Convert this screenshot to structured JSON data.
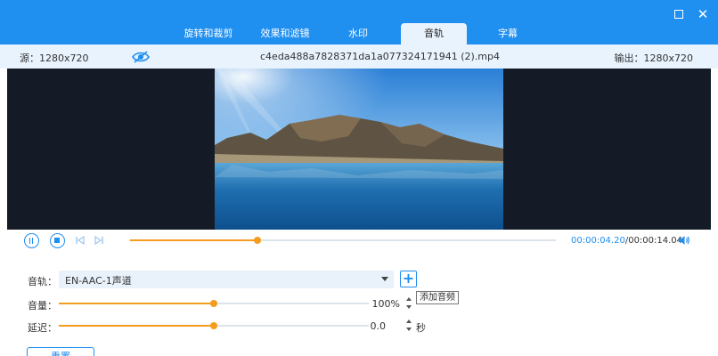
{
  "tabs": [
    {
      "label": "旋转和裁剪"
    },
    {
      "label": "效果和滤镜"
    },
    {
      "label": "水印"
    },
    {
      "label": "音轨",
      "active": true
    },
    {
      "label": "字幕"
    }
  ],
  "window": {
    "maximize_icon": "maximize-icon",
    "close_icon": "close-icon",
    "close_glyph": "✕"
  },
  "info": {
    "source": "源：1280x720",
    "filename": "c4eda488a7828371da1a077324171941 (2).mp4",
    "output": "输出：1280x720",
    "preview_icon": "eye-icon"
  },
  "playback": {
    "current": "00:00:04.20",
    "separator": "/",
    "total": "00:00:14.04",
    "progress": 0.3,
    "icons": [
      "pause-icon",
      "stop-icon",
      "skip-back-icon",
      "skip-forward-icon",
      "volume-icon"
    ]
  },
  "audio": {
    "track_label": "音轨：",
    "track_value": "EN-AAC-1声道",
    "add_button": "+",
    "add_tooltip": "添加音频",
    "volume_label": "音量：",
    "volume_value": "100%",
    "volume_level": 0.5,
    "delay_label": "延迟：",
    "delay_value": "0.0",
    "delay_unit": "秒",
    "delay_level": 0.5
  },
  "reset_label": "重置",
  "colors": {
    "accent": "#1f8ff0",
    "slider": "#f39c1e",
    "panel": "#e9f3fd",
    "video_bg": "#141b26"
  }
}
